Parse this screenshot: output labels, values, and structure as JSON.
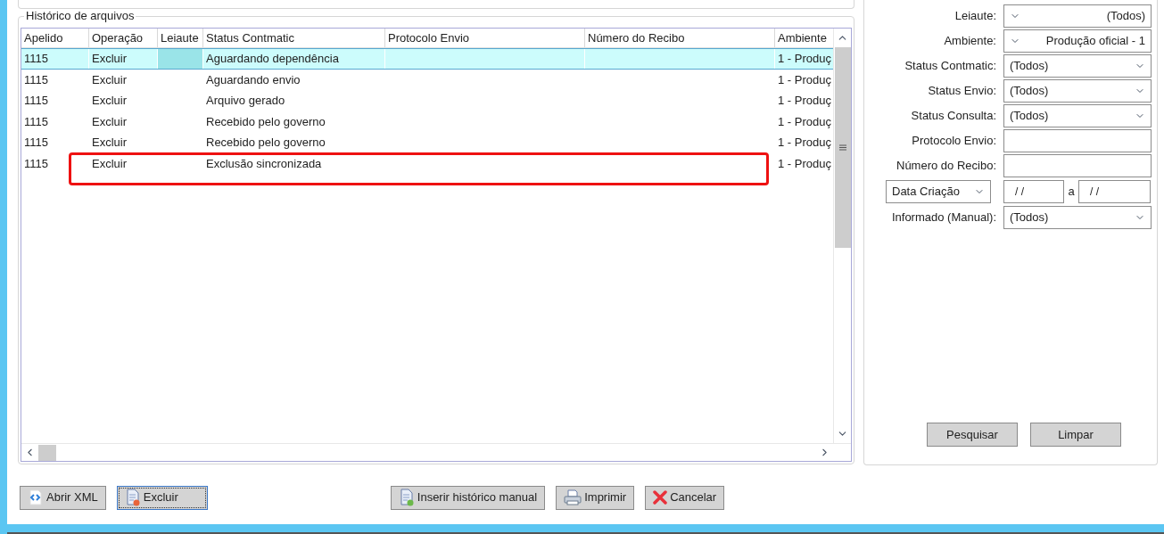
{
  "history": {
    "title": "Histórico de arquivos",
    "columns": [
      "Apelido",
      "Operação",
      "Leiaute",
      "Status Contmatic",
      "Protocolo Envio",
      "Número do Recibo",
      "Ambiente"
    ],
    "rows": [
      {
        "selected": true,
        "cells": [
          "1115",
          "Excluir",
          "",
          "Aguardando dependência",
          "",
          "",
          "1 - Produç"
        ]
      },
      {
        "selected": false,
        "cells": [
          "1115",
          "Excluir",
          "",
          "Aguardando envio",
          "",
          "",
          "1 - Produç"
        ]
      },
      {
        "selected": false,
        "cells": [
          "1115",
          "Excluir",
          "",
          "Arquivo gerado",
          "",
          "",
          "1 - Produç"
        ]
      },
      {
        "selected": false,
        "cells": [
          "1115",
          "Excluir",
          "",
          "Recebido pelo governo",
          "",
          "",
          "1 - Produç"
        ]
      },
      {
        "selected": false,
        "cells": [
          "1115",
          "Excluir",
          "",
          "Recebido pelo governo",
          "",
          "",
          "1 - Produç"
        ]
      },
      {
        "selected": false,
        "cells": [
          "1115",
          "Excluir",
          "",
          "Exclusão sincronizada",
          "",
          "",
          "1 - Produç"
        ]
      }
    ]
  },
  "filters": [
    {
      "kind": "combo",
      "label": "Leiaute:",
      "value": "(Todos)"
    },
    {
      "kind": "combo",
      "label": "Ambiente:",
      "value": "Produção oficial - 1"
    },
    {
      "kind": "select",
      "label": "Status Contmatic:",
      "value": "(Todos)"
    },
    {
      "kind": "select",
      "label": "Status Envio:",
      "value": "(Todos)"
    },
    {
      "kind": "select",
      "label": "Status Consulta:",
      "value": "(Todos)"
    },
    {
      "kind": "text",
      "label": "Protocolo Envio:"
    },
    {
      "kind": "text",
      "label": "Número do Recibo:"
    },
    {
      "kind": "date_range",
      "selector": "Data Criação",
      "from": "/ /",
      "separator": "a",
      "to": "/ /"
    },
    {
      "kind": "select",
      "label": "Informado (Manual):",
      "value": "(Todos)"
    }
  ],
  "filter_buttons": [
    "Pesquisar",
    "Limpar"
  ],
  "buttons": [
    {
      "label": "Abrir XML",
      "focused": false
    },
    {
      "label": "Excluir",
      "focused": true
    },
    {
      "label": "Inserir histórico manual",
      "focused": false
    },
    {
      "label": "Imprimir",
      "focused": false
    },
    {
      "label": "Cancelar",
      "focused": false
    }
  ]
}
